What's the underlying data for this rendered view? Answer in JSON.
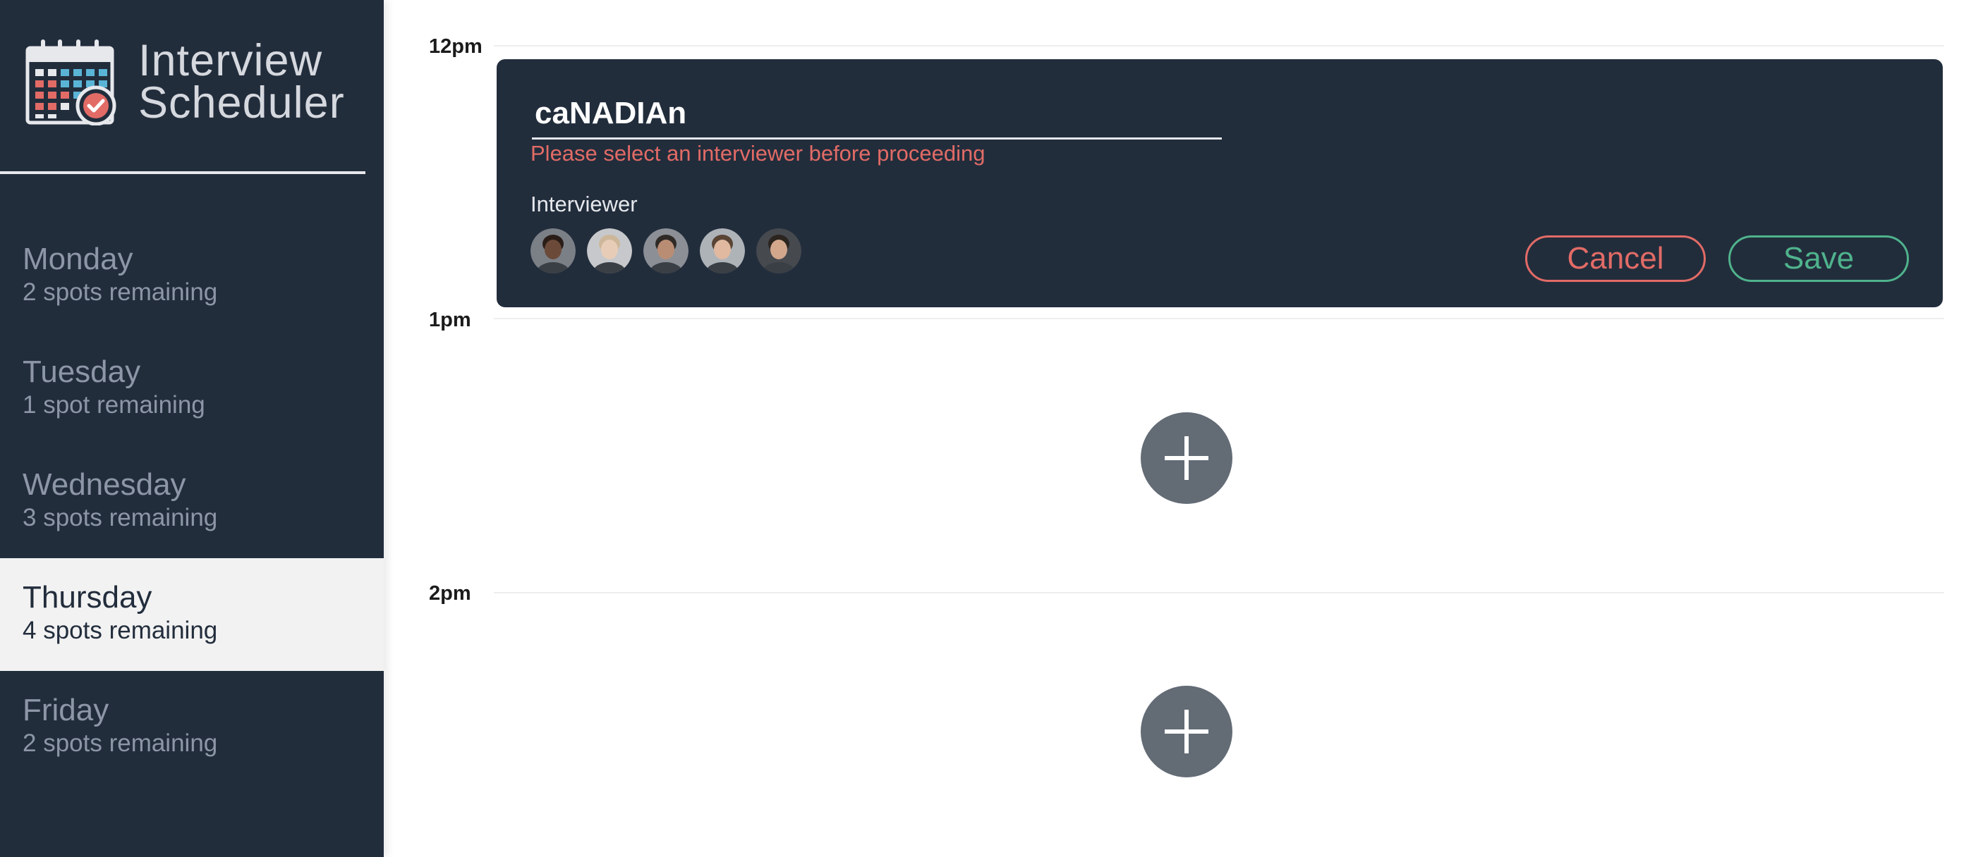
{
  "brand": {
    "logo_icon": "calendar-check-icon",
    "title_line1": "Interview",
    "title_line2": "Scheduler"
  },
  "days": [
    {
      "name": "Monday",
      "spots": "2 spots remaining",
      "selected": false
    },
    {
      "name": "Tuesday",
      "spots": "1 spot remaining",
      "selected": false
    },
    {
      "name": "Wednesday",
      "spots": "3 spots remaining",
      "selected": false
    },
    {
      "name": "Thursday",
      "spots": "4 spots remaining",
      "selected": true
    },
    {
      "name": "Friday",
      "spots": "2 spots remaining",
      "selected": false
    }
  ],
  "schedule": {
    "times": [
      "12pm",
      "1pm",
      "2pm"
    ]
  },
  "form": {
    "student_name": "caNADIAn",
    "error": "Please select an interviewer before proceeding",
    "interviewer_heading": "Interviewer",
    "interviewers": [
      {
        "icon": "avatar-icon",
        "skin": "#6b4a3a",
        "hair": "#2a1d17",
        "bg": "#7b7f86"
      },
      {
        "icon": "avatar-icon",
        "skin": "#e7cdb8",
        "hair": "#cdb79a",
        "bg": "#c6c8cb"
      },
      {
        "icon": "avatar-icon",
        "skin": "#b98d74",
        "hair": "#2f2a26",
        "bg": "#8c9096"
      },
      {
        "icon": "avatar-icon",
        "skin": "#e0b9a0",
        "hair": "#5a4535",
        "bg": "#aeb3b8"
      },
      {
        "icon": "avatar-icon",
        "skin": "#d2a78c",
        "hair": "#2b241f",
        "bg": "#46494e"
      }
    ],
    "cancel_label": "Cancel",
    "save_label": "Save"
  },
  "colors": {
    "sidebar_bg": "#222d3c",
    "selected_day_bg": "#f2f2f2",
    "danger": "#e26b66",
    "success": "#4fb38c",
    "add_button": "#636b75"
  }
}
